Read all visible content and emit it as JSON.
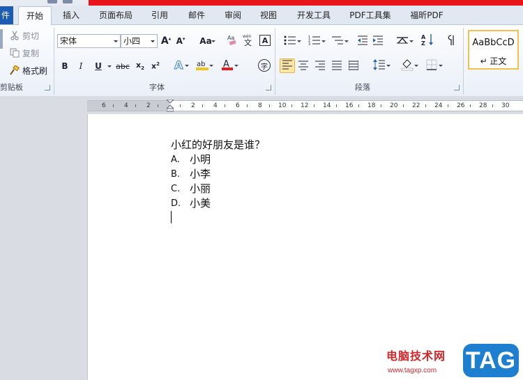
{
  "tabs": {
    "file": "件",
    "items": [
      "开始",
      "插入",
      "页面布局",
      "引用",
      "邮件",
      "审阅",
      "视图",
      "开发工具",
      "PDF工具集",
      "福昕PDF"
    ]
  },
  "clipboard": {
    "cut": "剪切",
    "copy": "复制",
    "format_painter": "格式刷",
    "group_label": "剪贴板"
  },
  "font": {
    "name": "宋体",
    "size": "小四",
    "case_label": "Aa",
    "group_label": "字体",
    "underline_color": "#f0c419",
    "font_color": "#e81e1e"
  },
  "paragraph": {
    "group_label": "段落"
  },
  "styles": {
    "sample": "AaBbCcD",
    "name": "↵ 正文"
  },
  "ruler": {
    "numbers": [
      "6",
      "4",
      "2",
      "2",
      "4",
      "6",
      "8",
      "10",
      "12",
      "14",
      "16",
      "18",
      "20",
      "22",
      "24",
      "26",
      "28",
      "30"
    ]
  },
  "document": {
    "question": "小红的好朋友是谁？",
    "options": [
      {
        "letter": "A.",
        "text": "小明"
      },
      {
        "letter": "B.",
        "text": "小李"
      },
      {
        "letter": "C.",
        "text": "小丽"
      },
      {
        "letter": "D.",
        "text": "小美"
      }
    ]
  },
  "watermark": {
    "text": "电脑技术网",
    "url": "www.tagxp.com",
    "logo": "TAG"
  },
  "colors": {
    "accent_red": "#e8151b",
    "file_tab": "#1d5cb4",
    "active_button": "#fde6a4",
    "watermark_blue": "#1e7fd0"
  }
}
